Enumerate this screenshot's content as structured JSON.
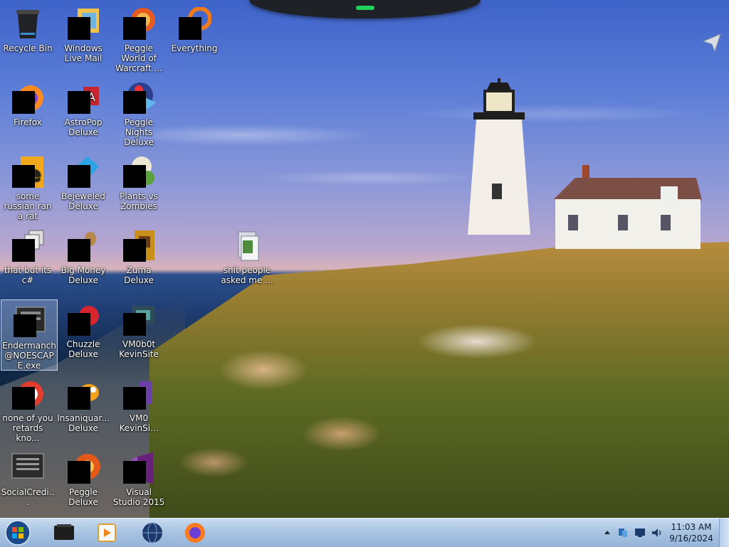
{
  "desktop_icons": [
    {
      "label": "Recycle Bin"
    },
    {
      "label": "Windows Live Mail"
    },
    {
      "label": "Peggle World of Warcraft ..."
    },
    {
      "label": "Everything"
    },
    {
      "label": "Firefox"
    },
    {
      "label": "AstroPop Deluxe"
    },
    {
      "label": "Peggle Nights Deluxe"
    },
    {
      "label": "some russian ran a rat"
    },
    {
      "label": "Bejeweled Deluxe"
    },
    {
      "label": "Plants vs Zombies"
    },
    {
      "label": "that but its c#"
    },
    {
      "label": "Big Money Deluxe"
    },
    {
      "label": "Zuma Deluxe"
    },
    {
      "label": "shit people asked me ..."
    },
    {
      "label": "Endermanch @NOESCAPE.exe"
    },
    {
      "label": "Chuzzle Deluxe"
    },
    {
      "label": "VM0b0t KevinSite"
    },
    {
      "label": "none of you retards kno..."
    },
    {
      "label": "Insaniquar... Deluxe"
    },
    {
      "label": "VM0 KevinSi..."
    },
    {
      "label": "SocialCredi..."
    },
    {
      "label": "Peggle Deluxe"
    },
    {
      "label": "Visual Studio 2015"
    }
  ],
  "taskbar": {
    "pinned": [
      "file-explorer-icon",
      "media-player-icon",
      "globe-icon",
      "firefox-icon"
    ],
    "tray_icons": [
      "show-hidden-icons-chevron",
      "network-icon",
      "display-icon",
      "volume-icon"
    ],
    "clock": {
      "time": "11:03 AM",
      "date": "9/16/2024"
    }
  },
  "colors": {
    "taskbar": "#a9c4e2",
    "selection": "#bed2f0"
  }
}
